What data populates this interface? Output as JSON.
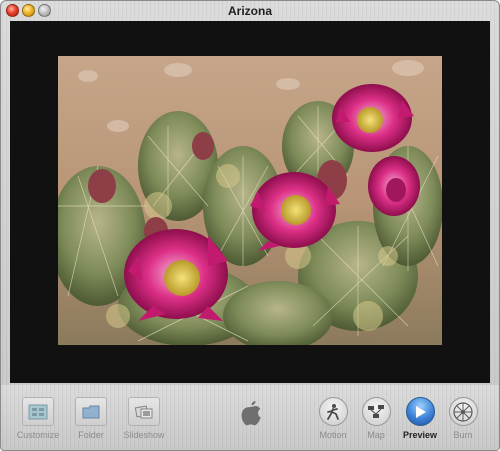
{
  "window": {
    "title": "Arizona"
  },
  "toolbar": {
    "buttons": [
      {
        "id": "customize",
        "label": "Customize",
        "icon": "customize-icon",
        "enabled": false
      },
      {
        "id": "folder",
        "label": "Folder",
        "icon": "folder-icon",
        "enabled": false
      },
      {
        "id": "slideshow",
        "label": "Slideshow",
        "icon": "slideshow-icon",
        "enabled": false
      },
      {
        "id": "motion",
        "label": "Motion",
        "icon": "motion-icon",
        "enabled": true
      },
      {
        "id": "map",
        "label": "Map",
        "icon": "map-icon",
        "enabled": true
      },
      {
        "id": "preview",
        "label": "Preview",
        "icon": "play-icon",
        "enabled": true,
        "active": true
      },
      {
        "id": "burn",
        "label": "Burn",
        "icon": "burn-icon",
        "enabled": true
      }
    ],
    "center_logo": "apple-logo-icon"
  },
  "colors": {
    "accent_blue": "#3b82d6",
    "viewer_background": "#111111",
    "flower_magenta": "#d1207a"
  }
}
